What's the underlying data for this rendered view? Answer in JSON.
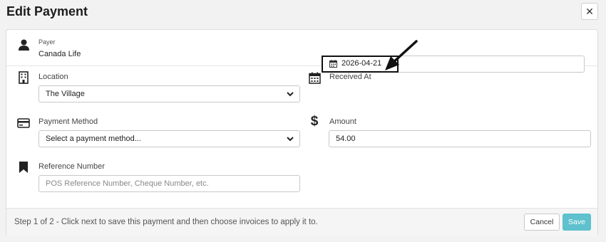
{
  "dialog": {
    "title": "Edit Payment",
    "close_label": "✕"
  },
  "payer": {
    "label": "Payer",
    "value": "Canada Life"
  },
  "location": {
    "label": "Location",
    "selected": "The Village"
  },
  "received_at": {
    "label": "Received At",
    "value": "2026-04-21"
  },
  "payment_method": {
    "label": "Payment Method",
    "selected": "Select a payment method..."
  },
  "amount": {
    "label": "Amount",
    "value": "54.00"
  },
  "reference": {
    "label": "Reference Number",
    "placeholder": "POS Reference Number, Cheque Number, etc."
  },
  "footer": {
    "step_text": "Step 1 of 2 - Click next to save this payment and then choose invoices to apply it to.",
    "cancel_label": "Cancel",
    "save_label": "Save"
  },
  "colors": {
    "accent": "#5ec1cd",
    "highlight_border": "#111111"
  },
  "icons": {
    "payer": "person-icon",
    "location": "building-icon",
    "received_at": "calendar-icon",
    "payment_method": "credit-card-icon",
    "amount": "dollar-icon",
    "reference": "bookmark-icon"
  }
}
